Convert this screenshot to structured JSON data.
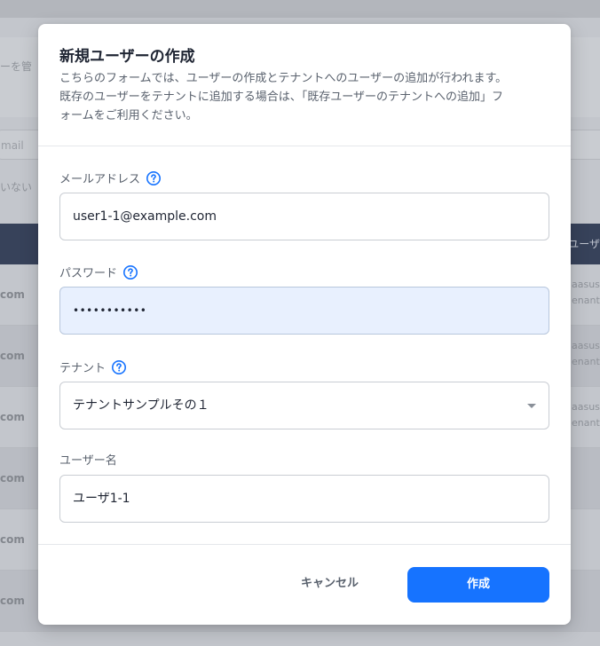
{
  "background": {
    "subtitle_fragment": "ーを管",
    "search_placeholder_fragment": "mail",
    "filter_fragment": "いない",
    "table_header_fragment": "ユーザ",
    "rows": [
      {
        "left": "com",
        "right": "aasus enant"
      },
      {
        "left": "com",
        "right": "aasus enant"
      },
      {
        "left": "com",
        "right": "aasus enant"
      },
      {
        "left": "com",
        "right": ""
      },
      {
        "left": "com",
        "right": ""
      },
      {
        "left": "com",
        "right": ""
      }
    ]
  },
  "modal": {
    "title": "新規ユーザーの作成",
    "description": [
      "こちらのフォームでは、ユーザーの作成とテナントへのユーザーの追加が行われます。",
      "既存のユーザーをテナントに追加する場合は、「既存ユーザーのテナントへの追加」フ",
      "ォームをご利用ください。"
    ],
    "fields": {
      "email": {
        "label": "メールアドレス",
        "value": "user1-1@example.com"
      },
      "password": {
        "label": "パスワード",
        "value": "•••••••••••"
      },
      "tenant": {
        "label": "テナント",
        "selected": "テナントサンプルその１"
      },
      "username": {
        "label": "ユーザー名",
        "value": "ユーザ1-1"
      }
    },
    "footer": {
      "cancel_label": "キャンセル",
      "create_label": "作成"
    }
  },
  "colors": {
    "primary": "#1673ff",
    "help_icon": "#1673ff",
    "autofill_bg": "#e8f0fe",
    "overlay": "#c3c6cc"
  },
  "icons": {
    "help": "question-circle-icon",
    "select": "caret-down-icon"
  }
}
